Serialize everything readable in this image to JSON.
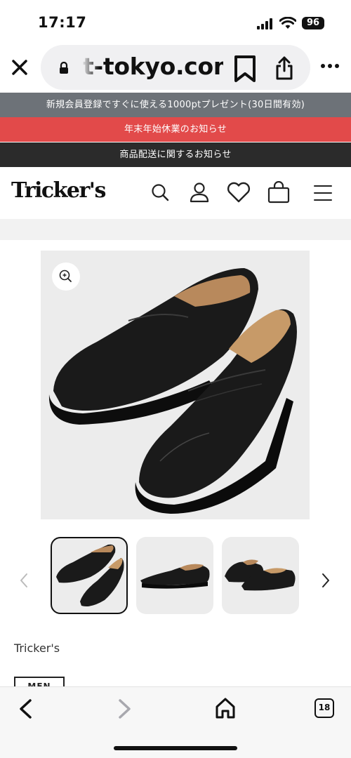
{
  "status": {
    "time": "17:17",
    "battery": "96"
  },
  "browser": {
    "url": "t-tokyo.com",
    "tab_count": "18"
  },
  "banners": [
    {
      "text": "新規会員登録ですぐに使える1000ptプレゼント(30日間有効)",
      "color": "#6d7278"
    },
    {
      "text": "年末年始休業のお知らせ",
      "color": "#e24a4a"
    },
    {
      "text": "商品配送に関するお知らせ",
      "color": "#2b2b2b"
    }
  ],
  "site": {
    "logo": "Tricker's"
  },
  "product": {
    "brand": "Tricker's",
    "category_tag": "MEN"
  },
  "icons": {
    "header": [
      "search-icon",
      "user-icon",
      "heart-icon",
      "bag-icon",
      "menu-icon"
    ],
    "browser": [
      "close-icon",
      "lock-icon",
      "bookmark-icon",
      "share-icon",
      "more-icon"
    ],
    "toolbar": [
      "back-icon",
      "forward-icon",
      "home-icon",
      "tabs-icon"
    ]
  }
}
